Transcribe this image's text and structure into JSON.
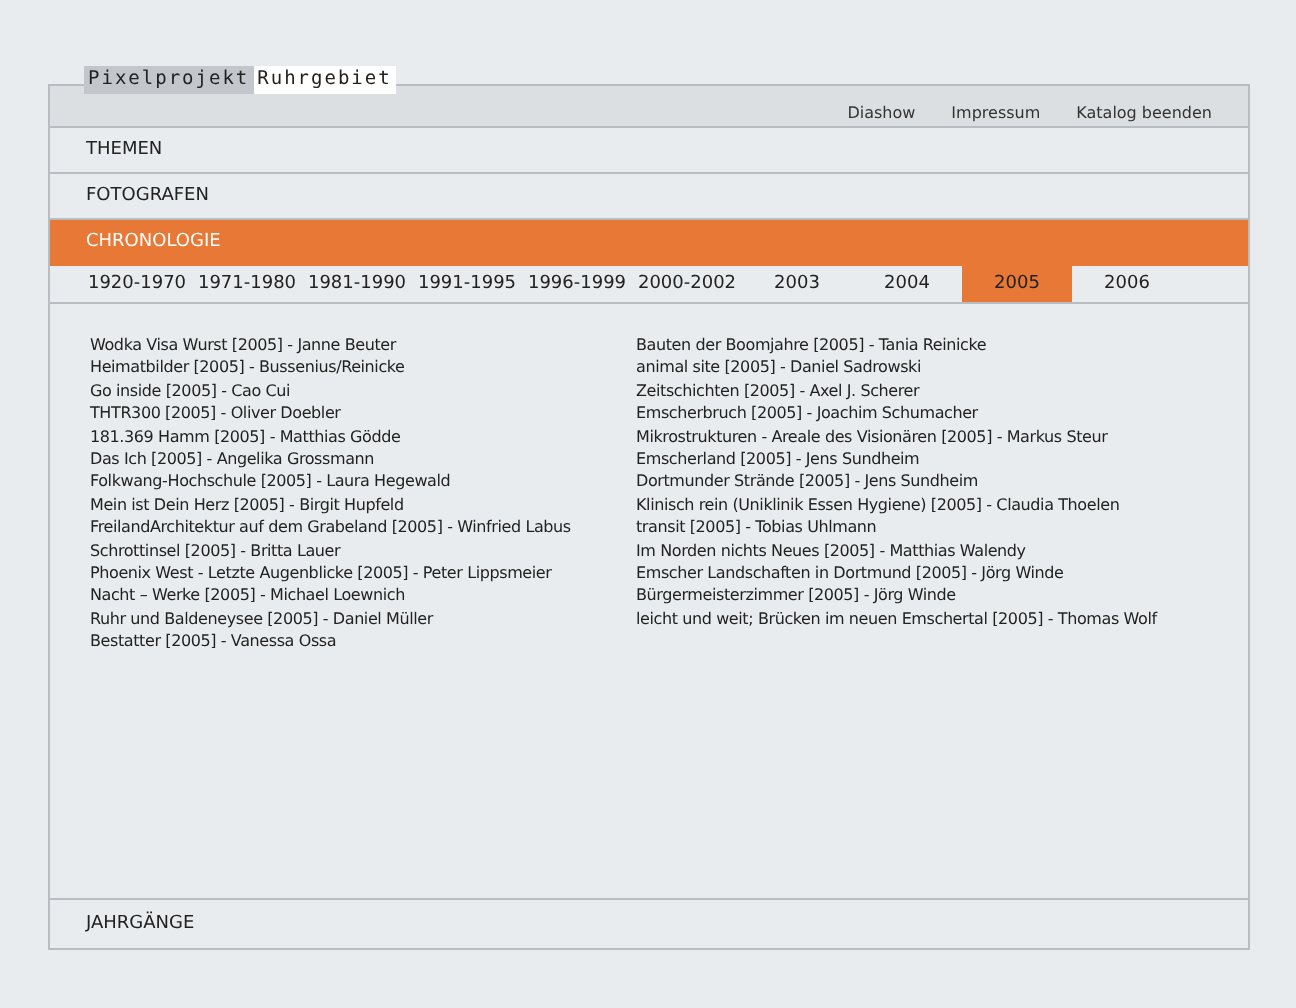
{
  "logo": {
    "part_1": "Pixelprojekt",
    "part_2": "Ruhrgebiet"
  },
  "top_links": [
    "Diashow",
    "Impressum",
    "Katalog beenden"
  ],
  "sections": [
    {
      "label": "THEMEN",
      "selected": false
    },
    {
      "label": "FOTOGRAFEN",
      "selected": false
    },
    {
      "label": "CHRONOLOGIE",
      "selected": true
    }
  ],
  "years": [
    {
      "label": "1920-1970",
      "selected": false
    },
    {
      "label": "1971-1980",
      "selected": false
    },
    {
      "label": "1981-1990",
      "selected": false
    },
    {
      "label": "1991-1995",
      "selected": false
    },
    {
      "label": "1996-1999",
      "selected": false
    },
    {
      "label": "2000-2002",
      "selected": false
    },
    {
      "label": "2003",
      "selected": false
    },
    {
      "label": "2004",
      "selected": false
    },
    {
      "label": "2005",
      "selected": true
    },
    {
      "label": "2006",
      "selected": false
    }
  ],
  "entries_left": [
    "Wodka Visa Wurst [2005] - Janne Beuter",
    "Heimatbilder [2005] - Bussenius/Reinicke",
    "Go inside [2005] - Cao Cui",
    "THTR300 [2005] - Oliver Doebler",
    "181.369 Hamm [2005] - Matthias Gödde",
    "Das Ich [2005] - Angelika Grossmann",
    "Folkwang-Hochschule [2005] - Laura Hegewald",
    "Mein ist Dein Herz [2005] - Birgit Hupfeld",
    "FreilandArchitektur auf dem Grabeland [2005] - Winfried Labus",
    "Schrottinsel [2005] - Britta Lauer",
    "Phoenix West - Letzte Augenblicke [2005] - Peter Lippsmeier",
    "Nacht – Werke [2005] - Michael Loewnich",
    "Ruhr und Baldeneysee [2005] - Daniel Müller",
    "Bestatter [2005] - Vanessa Ossa"
  ],
  "entries_right": [
    "Bauten der Boomjahre [2005] - Tania Reinicke",
    "animal site [2005] - Daniel Sadrowski",
    "Zeitschichten [2005] - Axel J. Scherer",
    "Emscherbruch [2005] - Joachim Schumacher",
    "Mikrostrukturen - Areale des Visionären [2005] - Markus Steur",
    "Emscherland [2005] - Jens Sundheim",
    "Dortmunder Strände [2005] - Jens Sundheim",
    "Klinisch rein  (Uniklinik Essen Hygiene) [2005] - Claudia Thoelen",
    "transit [2005] - Tobias Uhlmann",
    "Im Norden nichts Neues [2005] - Matthias Walendy",
    "Emscher Landschaften in Dortmund [2005] - Jörg Winde",
    "Bürgermeisterzimmer [2005] - Jörg Winde",
    "leicht und weit; Brücken im neuen Emschertal [2005] - Thomas Wolf"
  ],
  "footer_section": "JAHRGÄNGE"
}
